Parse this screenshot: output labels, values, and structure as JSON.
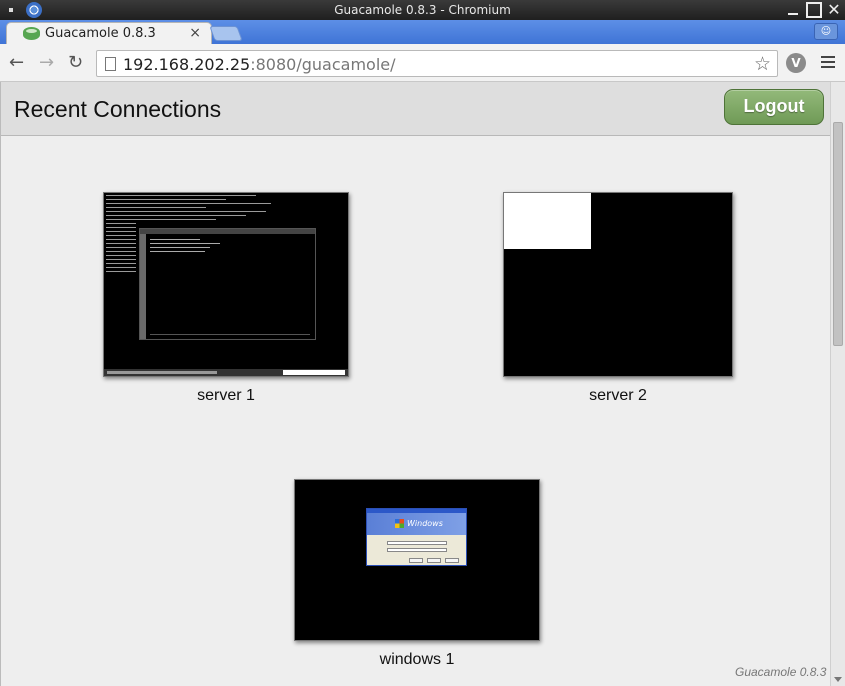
{
  "window": {
    "title": "Guacamole 0.8.3 - Chromium"
  },
  "browser": {
    "tab_title": "Guacamole 0.8.3",
    "tab_close": "×",
    "url_host": "192.168.202.25",
    "url_rest": ":8080/guacamole/"
  },
  "header": {
    "title": "Recent Connections",
    "logout_label": "Logout"
  },
  "connections": [
    {
      "name": "server 1"
    },
    {
      "name": "server 2"
    },
    {
      "name": "windows 1"
    }
  ],
  "footer": {
    "version": "Guacamole 0.8.3"
  },
  "icons": {
    "close_glyph": "✕",
    "star_glyph": "☆",
    "back_glyph": "←",
    "forward_glyph": "→",
    "reload_glyph": "↻",
    "extension_glyph": "V"
  },
  "colors": {
    "logout_green": "#7ea865",
    "tab_blue": "#3f74d6"
  }
}
